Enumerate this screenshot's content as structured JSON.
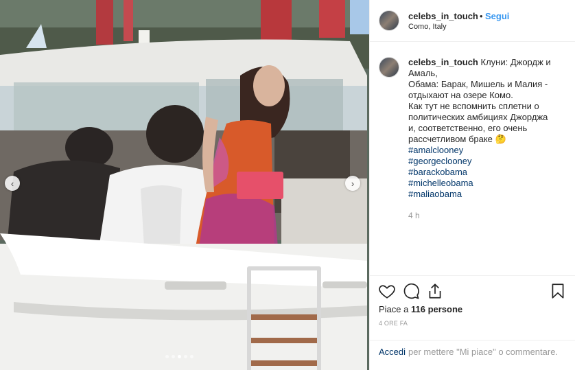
{
  "post": {
    "username": "celebs_in_touch",
    "follow_label": "Segui",
    "separator": "•",
    "location": "Como, Italy"
  },
  "caption": {
    "username": "celebs_in_touch",
    "lines": [
      "Клуни: Джордж и",
      "Амаль,",
      "Обама: Барак, Мишель и Малия -",
      "отдыхают на озере Комо.",
      "Как тут не вспомнить сплетни о",
      "политических амбициях Джорджа",
      "и, соответственно, его очень",
      "рассчетливом браке 🤔"
    ],
    "hashtags": [
      "#amalclooney",
      "#georgeclooney",
      "#barackobama",
      "#michelleobama",
      "#maliaobama"
    ],
    "time_ago": "4 h"
  },
  "actions": {
    "like_icon": "heart-icon",
    "comment_icon": "comment-icon",
    "share_icon": "share-icon",
    "save_icon": "bookmark-icon"
  },
  "likes": {
    "prefix": "Piace a ",
    "count": "116 persone"
  },
  "date_label": "4 ORE FA",
  "login": {
    "access_label": "Accedi",
    "rest_text": "per mettere \"Mi piace\" o commentare."
  },
  "carousel": {
    "prev_icon": "chevron-left-icon",
    "next_icon": "chevron-right-icon",
    "prev_glyph": "‹",
    "next_glyph": "›",
    "slide_count": 5,
    "active_index": 2
  },
  "colors": {
    "link_blue": "#3897f0",
    "hashtag": "#003569",
    "muted": "#999999",
    "text": "#262626"
  }
}
